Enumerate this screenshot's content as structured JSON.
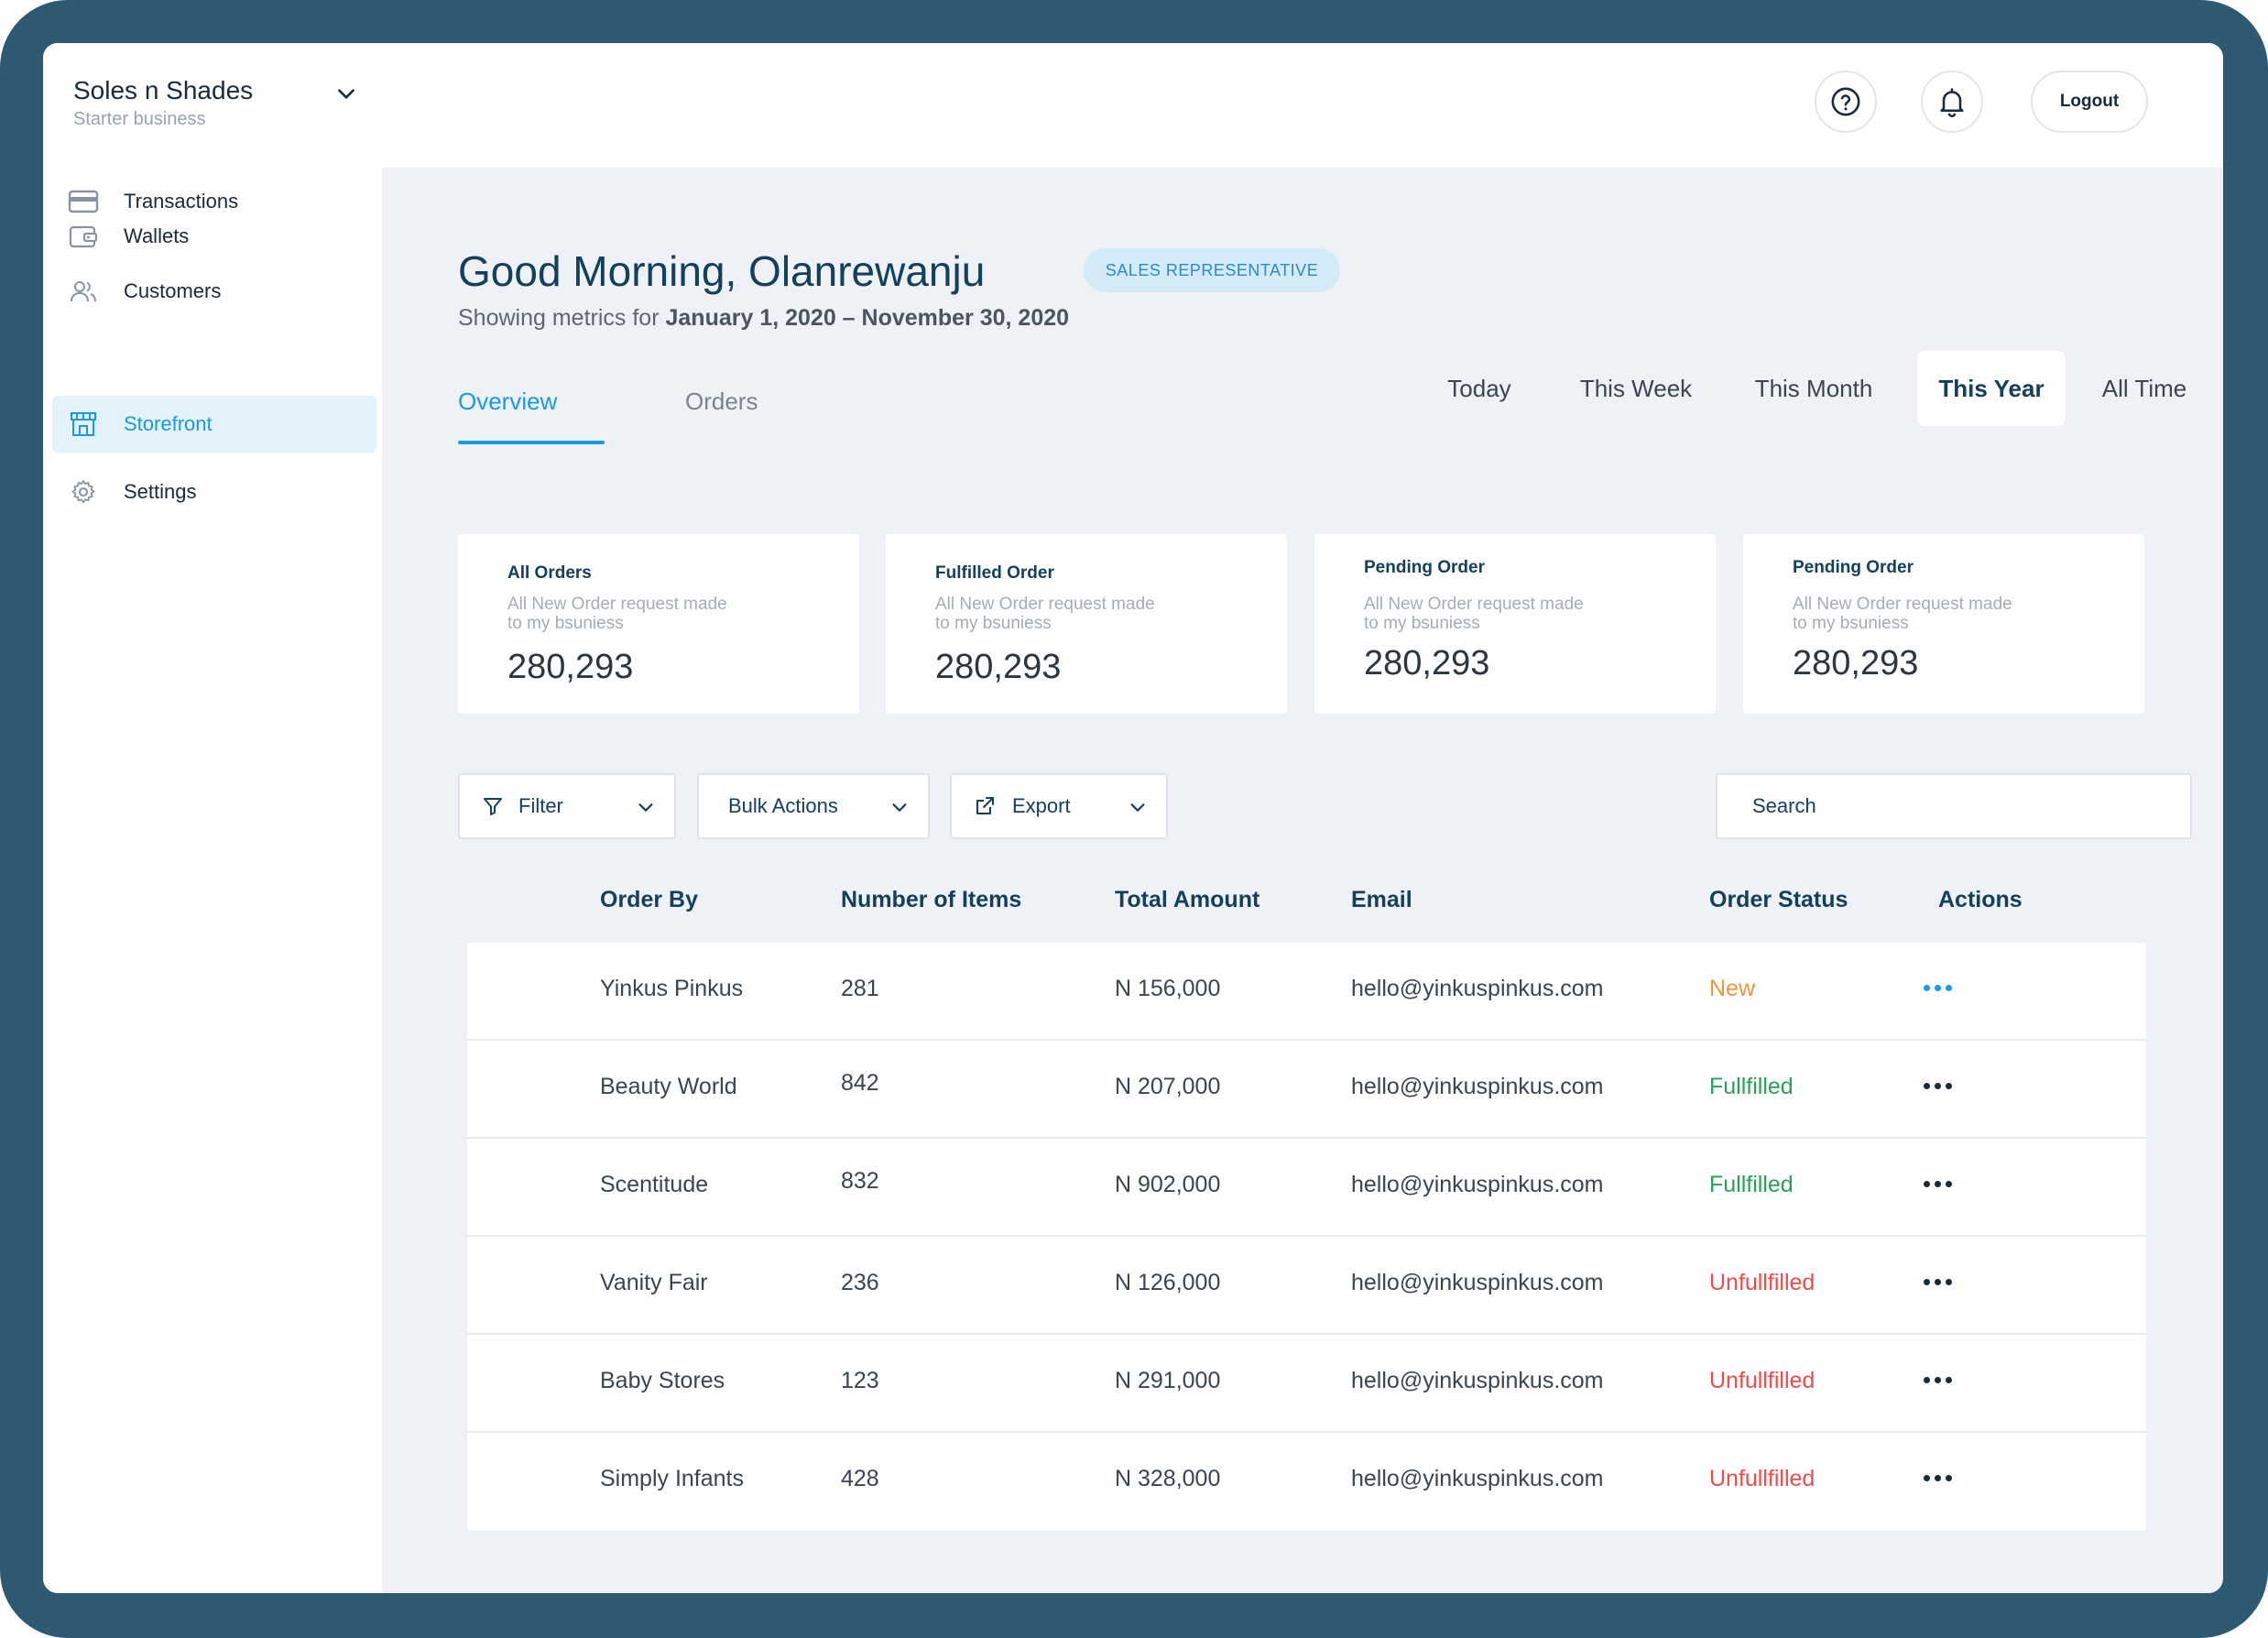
{
  "business": {
    "name": "Soles n Shades",
    "plan": "Starter business"
  },
  "header": {
    "help_icon": "help-circle-icon",
    "notifications_icon": "bell-icon",
    "logout_label": "Logout"
  },
  "sidebar": {
    "items": [
      {
        "label": "Transactions",
        "icon": "card-icon"
      },
      {
        "label": "Wallets",
        "icon": "wallet-icon"
      },
      {
        "label": "Customers",
        "icon": "users-icon"
      },
      {
        "label": "Storefront",
        "icon": "storefront-icon",
        "active": true
      },
      {
        "label": "Settings",
        "icon": "gear-icon"
      }
    ]
  },
  "page": {
    "greeting": "Good Morning, Olanrewanju",
    "role_badge": "SALES REPRESENTATIVE",
    "metrics_prefix": "Showing metrics for",
    "metrics_range": "January 1, 2020 – November 30, 2020",
    "tabs": [
      "Overview",
      "Orders"
    ],
    "active_tab": "Overview",
    "periods": [
      "Today",
      "This Week",
      "This Month",
      "This Year",
      "All Time"
    ],
    "active_period": "This Year"
  },
  "cards": [
    {
      "title": "All Orders",
      "subtitle": "All New Order request made to my bsuniess",
      "value": "280,293"
    },
    {
      "title": "Fulfilled Order",
      "subtitle": "All New Order request made to my bsuniess",
      "value": "280,293"
    },
    {
      "title": "Pending Order",
      "subtitle": "All New Order request made to my bsuniess",
      "value": "280,293"
    },
    {
      "title": "Pending Order",
      "subtitle": "All New Order request made to my bsuniess",
      "value": "280,293"
    }
  ],
  "toolbar": {
    "filter_label": "Filter",
    "bulk_label": "Bulk Actions",
    "export_label": "Export",
    "search_placeholder": "Search"
  },
  "table": {
    "columns": [
      "Order By",
      "Number of Items",
      "Total Amount",
      "Email",
      "Order Status",
      "Actions"
    ],
    "rows": [
      {
        "order_by": "Yinkus Pinkus",
        "items": "281",
        "amount": "N 156,000",
        "email": "hello@yinkuspinkus.com",
        "status": "New"
      },
      {
        "order_by": "Beauty World",
        "items": "842",
        "amount": "N 207,000",
        "email": "hello@yinkuspinkus.com",
        "status": "Fullfilled"
      },
      {
        "order_by": "Scentitude",
        "items": "832",
        "amount": "N 902,000",
        "email": "hello@yinkuspinkus.com",
        "status": "Fullfilled"
      },
      {
        "order_by": "Vanity Fair",
        "items": "236",
        "amount": "N 126,000",
        "email": "hello@yinkuspinkus.com",
        "status": "Unfullfilled"
      },
      {
        "order_by": "Baby Stores",
        "items": "123",
        "amount": "N 291,000",
        "email": "hello@yinkuspinkus.com",
        "status": "Unfullfilled"
      },
      {
        "order_by": "Simply Infants",
        "items": "428",
        "amount": "N 328,000",
        "email": "hello@yinkuspinkus.com",
        "status": "Unfullfilled"
      }
    ]
  },
  "colors": {
    "frame": "#2d5a72",
    "accent": "#1a9ae0",
    "new": "#f0963e",
    "fulfilled": "#2aa05a",
    "unfulfilled": "#ec4c4c"
  }
}
